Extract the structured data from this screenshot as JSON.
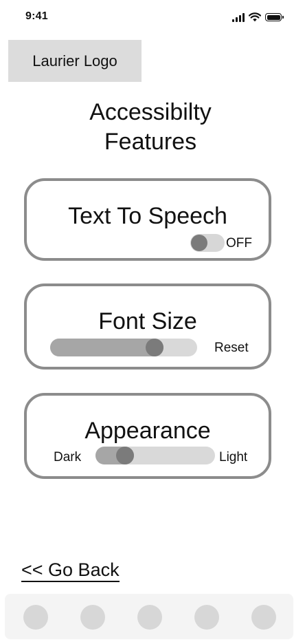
{
  "status_bar": {
    "time": "9:41",
    "icons": [
      "signal-icon",
      "wifi-icon",
      "battery-icon"
    ]
  },
  "header": {
    "logo_text": "Laurier Logo",
    "title": "Accessibilty\nFeatures"
  },
  "text_to_speech": {
    "title": "Text To Speech",
    "state_label": "OFF",
    "enabled": false
  },
  "font_size": {
    "title": "Font Size",
    "reset_label": "Reset",
    "level": 0.74
  },
  "appearance": {
    "title": "Appearance",
    "min_label": "Dark",
    "max_label": "Light",
    "level": 0.2
  },
  "navigation": {
    "back_label": "<< Go Back",
    "tab_count": 5
  },
  "colors": {
    "card_border": "#8c8c8c",
    "track": "#d9d9d9",
    "track_fill": "#a6a6a6",
    "knob": "#7b7b7b",
    "logo_bg": "#dcdcdc"
  }
}
